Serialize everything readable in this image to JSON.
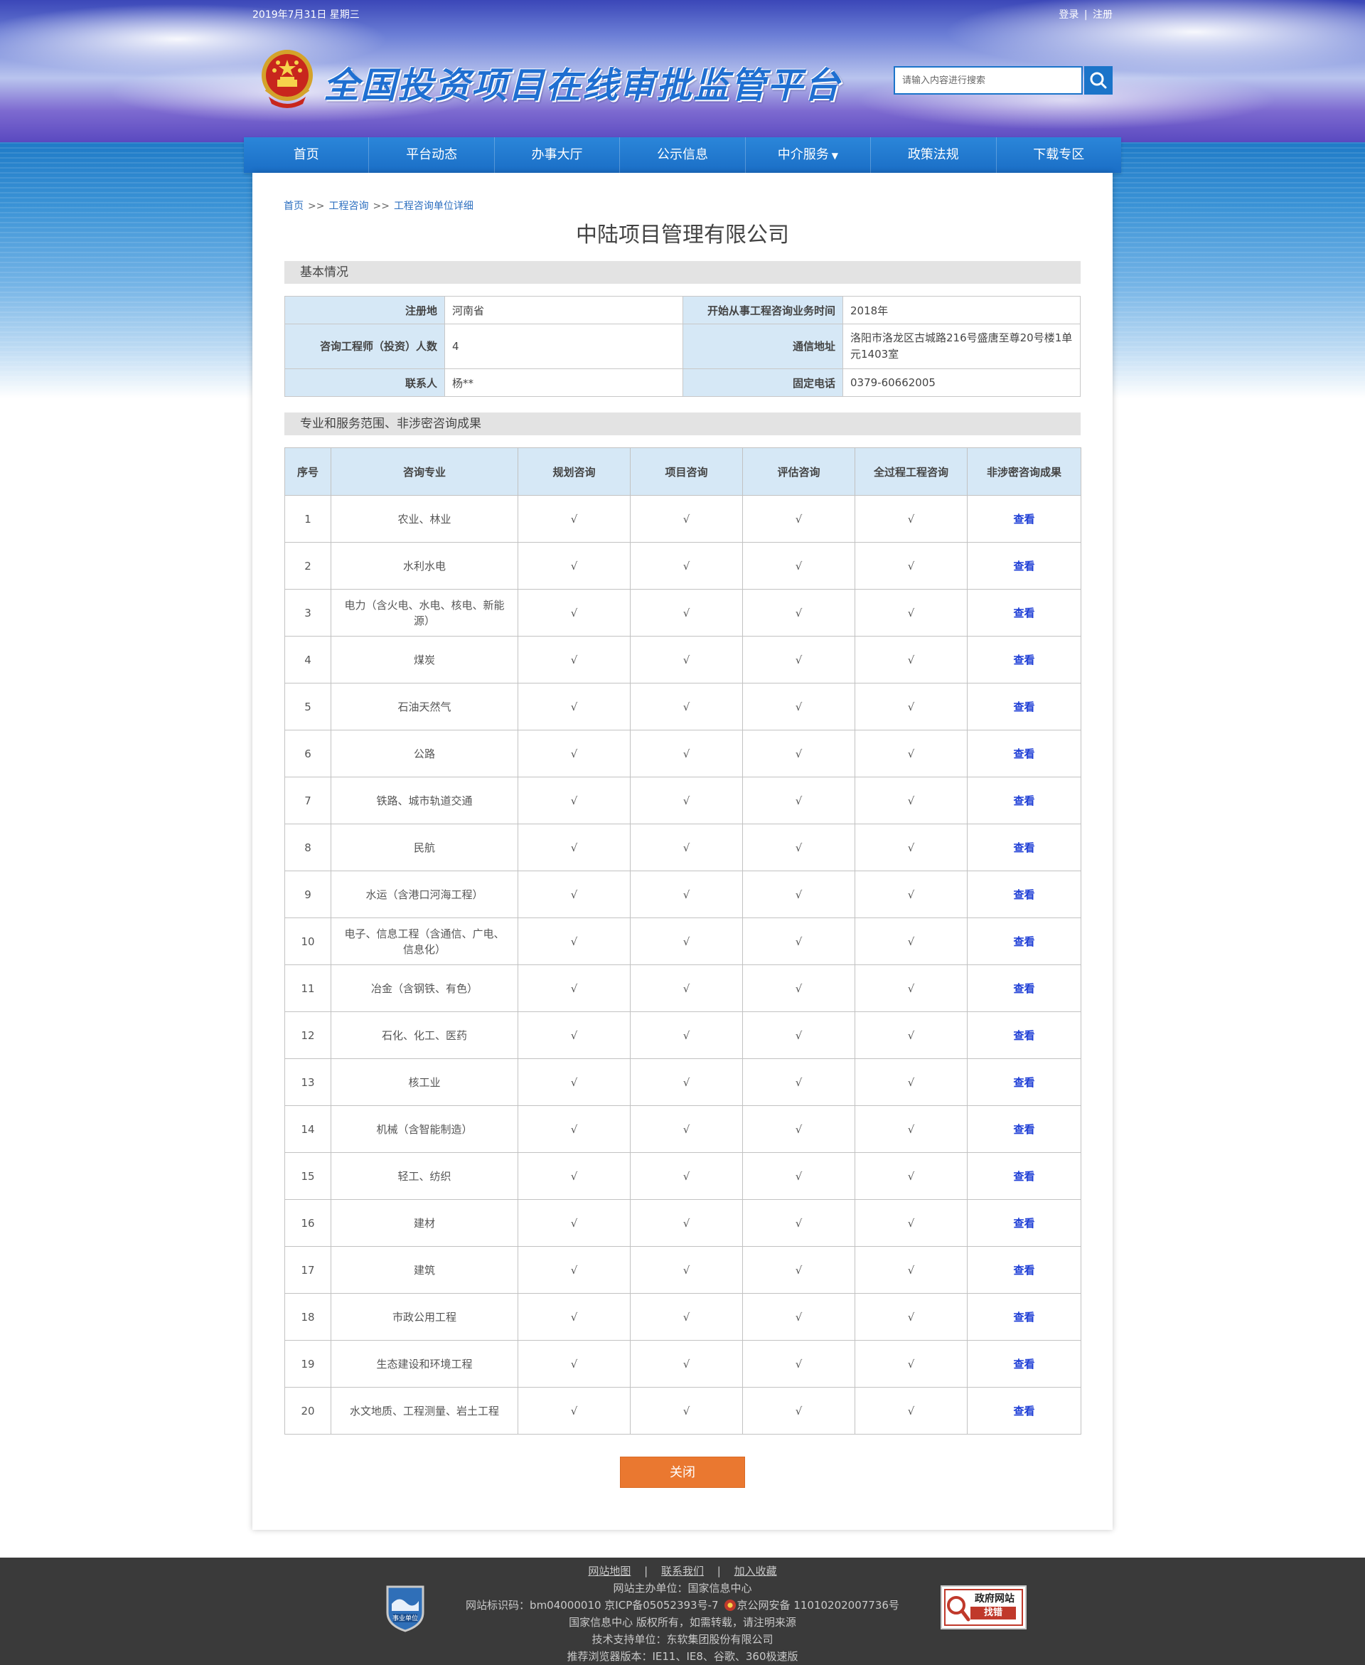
{
  "topbar": {
    "date": "2019年7月31日 星期三",
    "login": "登录",
    "divider": "|",
    "register": "注册"
  },
  "header": {
    "site_title": "全国投资项目在线审批监管平台",
    "search_placeholder": "请输入内容进行搜索",
    "search_icon": "magnifier-icon",
    "emblem_icon": "national-emblem-icon"
  },
  "nav": {
    "items": [
      {
        "label": "首页"
      },
      {
        "label": "平台动态"
      },
      {
        "label": "办事大厅"
      },
      {
        "label": "公示信息"
      },
      {
        "label": "中介服务",
        "caret": "▼"
      },
      {
        "label": "政策法规"
      },
      {
        "label": "下载专区"
      }
    ]
  },
  "breadcrumb": {
    "items": [
      "首页",
      "工程咨询",
      "工程咨询单位详细"
    ],
    "separator": ">>"
  },
  "company": {
    "name": "中陆项目管理有限公司"
  },
  "basic_section": {
    "title": "基本情况",
    "rows": [
      {
        "l1": "注册地",
        "v1": "河南省",
        "l2": "开始从事工程咨询业务时间",
        "v2": "2018年"
      },
      {
        "l1": "咨询工程师（投资）人数",
        "v1": "4",
        "l2": "通信地址",
        "v2": "洛阳市洛龙区古城路216号盛唐至尊20号楼1单元1403室"
      },
      {
        "l1": "联系人",
        "v1": "杨**",
        "l2": "固定电话",
        "v2": "0379-60662005"
      }
    ]
  },
  "scope_section": {
    "title": "专业和服务范围、非涉密咨询成果",
    "headers": [
      "序号",
      "咨询专业",
      "规划咨询",
      "项目咨询",
      "评估咨询",
      "全过程工程咨询",
      "非涉密咨询成果"
    ],
    "check": "√",
    "link_label": "查看",
    "rows": [
      {
        "no": "1",
        "name": "农业、林业"
      },
      {
        "no": "2",
        "name": "水利水电"
      },
      {
        "no": "3",
        "name": "电力（含火电、水电、核电、新能源）"
      },
      {
        "no": "4",
        "name": "煤炭"
      },
      {
        "no": "5",
        "name": "石油天然气"
      },
      {
        "no": "6",
        "name": "公路"
      },
      {
        "no": "7",
        "name": "铁路、城市轨道交通"
      },
      {
        "no": "8",
        "name": "民航"
      },
      {
        "no": "9",
        "name": "水运（含港口河海工程）"
      },
      {
        "no": "10",
        "name": "电子、信息工程（含通信、广电、信息化）"
      },
      {
        "no": "11",
        "name": "冶金（含钢铁、有色）"
      },
      {
        "no": "12",
        "name": "石化、化工、医药"
      },
      {
        "no": "13",
        "name": "核工业"
      },
      {
        "no": "14",
        "name": "机械（含智能制造）"
      },
      {
        "no": "15",
        "name": "轻工、纺织"
      },
      {
        "no": "16",
        "name": "建材"
      },
      {
        "no": "17",
        "name": "建筑"
      },
      {
        "no": "18",
        "name": "市政公用工程"
      },
      {
        "no": "19",
        "name": "生态建设和环境工程"
      },
      {
        "no": "20",
        "name": "水文地质、工程测量、岩土工程"
      }
    ]
  },
  "close_button": "关闭",
  "footer": {
    "links": [
      "网站地图",
      "联系我们",
      "加入收藏"
    ],
    "link_divider": "|",
    "host": "网站主办单位：国家信息中心",
    "id_line_a": "网站标识码：bm04000010  京ICP备05052393号-7",
    "id_line_b": "京公网安备 11010202007736号",
    "copyright": "国家信息中心 版权所有，如需转载，请注明来源",
    "tech": "技术支持单位：东软集团股份有限公司",
    "browser": "推荐浏览器版本：IE11、IE8、谷歌、360极速版",
    "badge_left_text": "事业单位",
    "badge_right_top": "政府网站",
    "badge_right_bottom": "找错"
  },
  "colors": {
    "nav_blue": "#1a6ec6",
    "table_header_bg": "#d6e8f6",
    "link_blue": "#1f3fd6",
    "close_orange": "#ea7830",
    "footer_bg": "#3a3a3a"
  }
}
